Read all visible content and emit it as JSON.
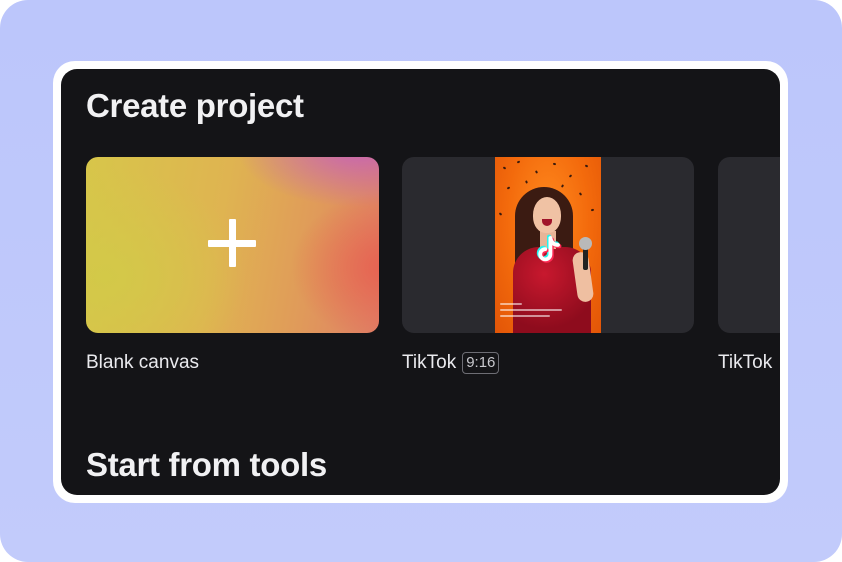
{
  "page": {
    "background": "#bcc6fb",
    "panel_background": "#141417"
  },
  "create_project": {
    "title": "Create project",
    "cards": [
      {
        "label": "Blank canvas",
        "icon": "plus-icon"
      },
      {
        "label": "TikTok",
        "ratio": "9:16",
        "icon": "tiktok-logo-icon"
      },
      {
        "label": "TikTok"
      }
    ]
  },
  "start_from_tools": {
    "title": "Start from tools"
  }
}
